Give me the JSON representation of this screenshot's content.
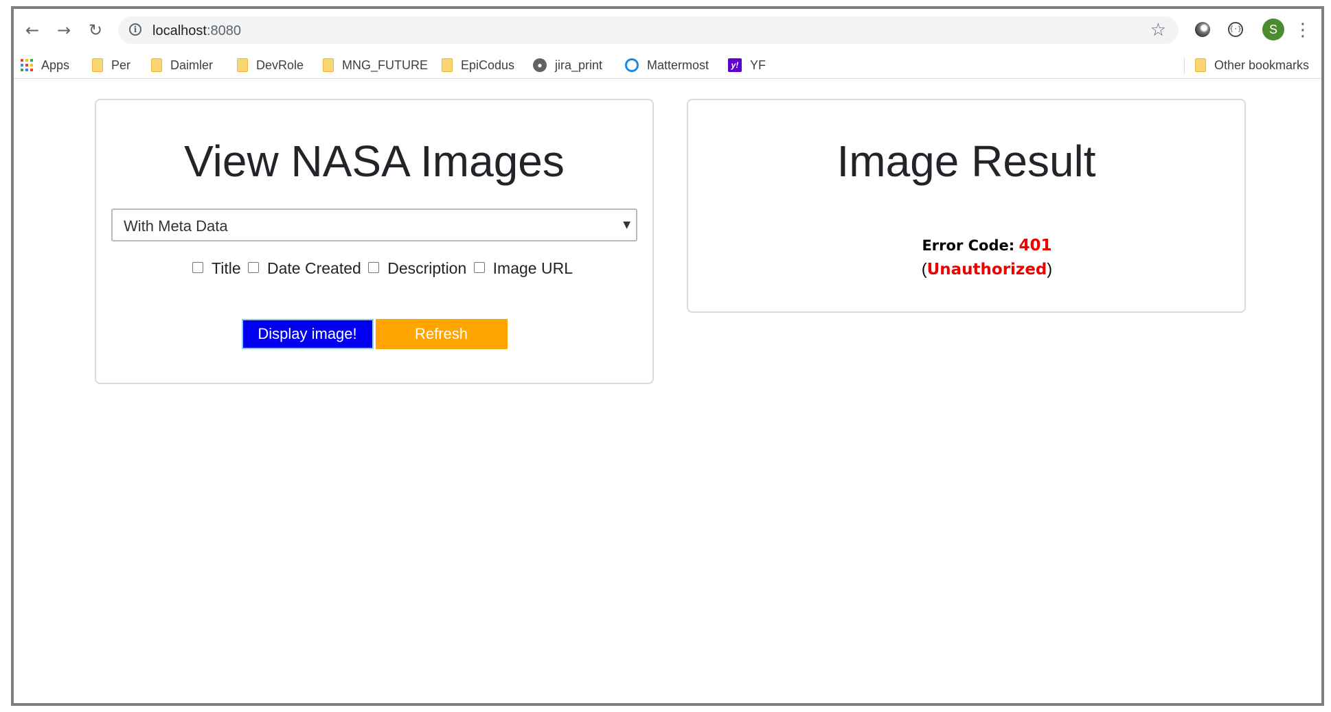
{
  "browser": {
    "url_host": "localhost",
    "url_port": ":8080",
    "profile_initial": "S",
    "bookmarks": [
      {
        "label": "Apps",
        "icon": "apps-grid-icon"
      },
      {
        "label": "Per",
        "icon": "folder-icon"
      },
      {
        "label": "Daimler",
        "icon": "folder-icon"
      },
      {
        "label": "DevRole",
        "icon": "folder-icon"
      },
      {
        "label": "MNG_FUTURE",
        "icon": "folder-icon"
      },
      {
        "label": "EpiCodus",
        "icon": "folder-icon"
      },
      {
        "label": "jira_print",
        "icon": "globe-icon"
      },
      {
        "label": "Mattermost",
        "icon": "mattermost-icon"
      },
      {
        "label": "YF",
        "icon": "yahoo-icon"
      }
    ],
    "other_bookmarks": "Other bookmarks"
  },
  "left_panel": {
    "title": "View NASA Images",
    "select_value": "With Meta Data",
    "checkboxes": [
      {
        "label": "Title",
        "checked": false
      },
      {
        "label": "Date Created",
        "checked": false
      },
      {
        "label": "Description",
        "checked": false
      },
      {
        "label": "Image URL",
        "checked": false
      }
    ],
    "display_button": "Display image!",
    "refresh_button": "Refresh"
  },
  "right_panel": {
    "title": "Image Result",
    "error_label": "Error Code:",
    "error_code": "401",
    "error_message": "Unauthorized"
  },
  "colors": {
    "display_button_bg": "#0000ee",
    "refresh_button_bg": "#ffa500",
    "error_red": "#ee0000",
    "avatar_green": "#4c8b2f"
  }
}
